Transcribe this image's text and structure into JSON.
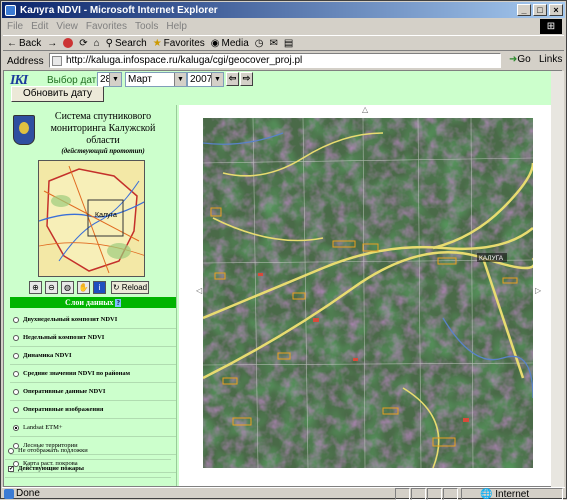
{
  "window": {
    "title": "Kaлуга NDVI - Microsoft Internet Explorer",
    "title_display": "Kалуга NDVI - Microsoft Internet Explorer",
    "buttons": {
      "min": "_",
      "max": "□",
      "close": "×"
    }
  },
  "menu": [
    "File",
    "Edit",
    "View",
    "Favorites",
    "Tools",
    "Help"
  ],
  "toolbar": {
    "back": "Back",
    "search": "Search",
    "favorites": "Favorites",
    "media": "Media"
  },
  "address": {
    "label": "Address",
    "url": "http://kaluga.infospace.ru/kaluga/cgi/geocover_proj.pl",
    "go": "Go",
    "links": "Links"
  },
  "controls": {
    "logo": "IKI",
    "date_label": "Выбор даты:",
    "day": "28",
    "month": "Март",
    "year": "2007",
    "prev": "⇦",
    "next": "⇨",
    "update_button": "Обновить дату"
  },
  "panel": {
    "title": "Система спутникового мониторинга Калужской области",
    "subtitle": "(действующий прототип)",
    "minimap_city": "Калуга",
    "reload": "Reload",
    "layers_header": "Слои данных",
    "layers_help": "?",
    "layers": [
      {
        "label": "Двухнедельный композит NDVI",
        "type": "radio",
        "checked": false,
        "bold": true
      },
      {
        "label": "Недельный композит NDVI",
        "type": "radio",
        "checked": false,
        "bold": true
      },
      {
        "label": "Динамика NDVI",
        "type": "radio",
        "checked": false,
        "bold": true
      },
      {
        "label": "Средние значения NDVI по районам",
        "type": "radio",
        "checked": false,
        "bold": true
      },
      {
        "label": "Оперативные данные NDVI",
        "type": "radio",
        "checked": false,
        "bold": true
      },
      {
        "label": "Оперативные изображения",
        "type": "radio",
        "checked": false,
        "bold": true
      },
      {
        "label": "Landsat ETM+",
        "type": "radio",
        "checked": true,
        "bold": false
      },
      {
        "label": "Лесные территории",
        "type": "radio",
        "checked": false,
        "bold": false
      },
      {
        "label": "Карта раст. покрова",
        "type": "radio",
        "checked": false,
        "bold": false
      },
      {
        "label": "Не отображать подложки",
        "type": "radio",
        "checked": false,
        "bold": false
      },
      {
        "label": "Действующие пожары",
        "type": "checkbox",
        "checked": true,
        "bold": true
      }
    ]
  },
  "map": {
    "city_label": "КАЛУГА"
  },
  "status": {
    "text": "Done",
    "zone": "Internet"
  }
}
